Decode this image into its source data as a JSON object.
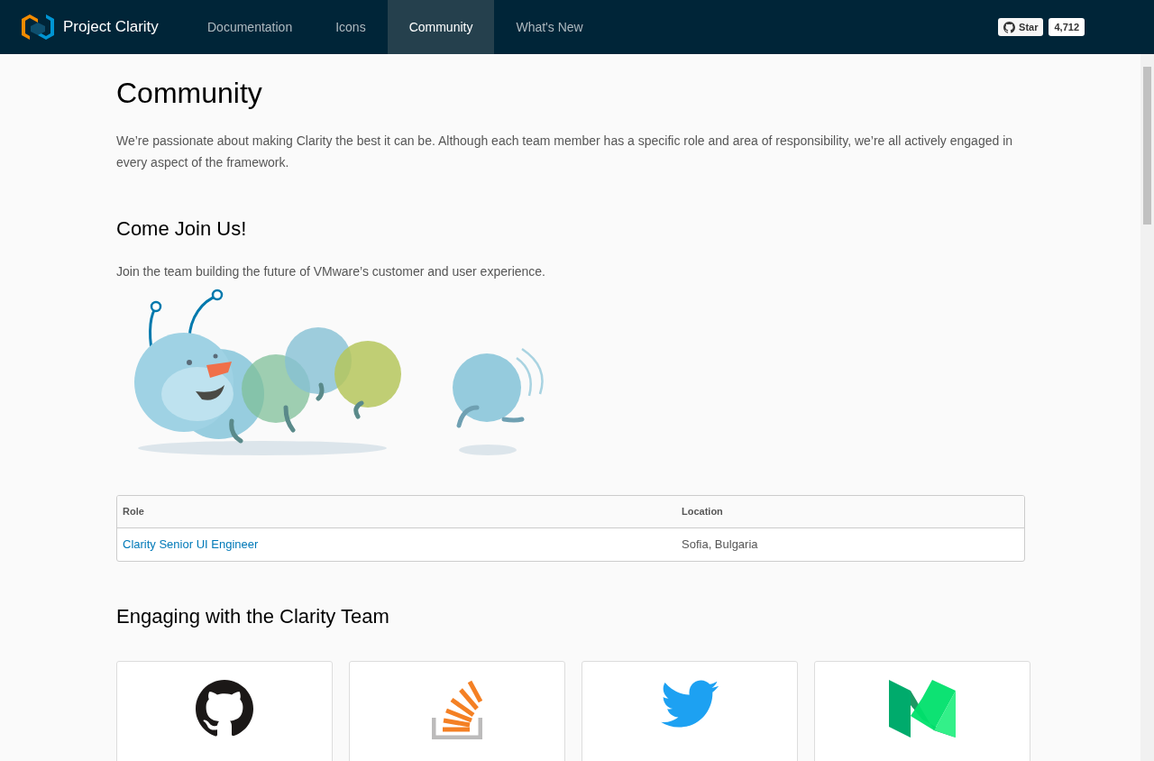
{
  "nav": {
    "brand": "Project Clarity",
    "tabs": [
      {
        "label": "Documentation",
        "selected": false
      },
      {
        "label": "Icons",
        "selected": false
      },
      {
        "label": "Community",
        "selected": true
      },
      {
        "label": "What's New",
        "selected": false
      }
    ]
  },
  "github": {
    "star": "Star",
    "count": "4,712"
  },
  "title": "Community",
  "intro": "We’re passionate about making Clarity the best it can be. Although each team member has a specific role and area of responsibility, we’re all actively engaged in every aspect of the framework.",
  "join": {
    "heading": "Come Join Us!",
    "text": "Join the team building the future of VMware’s customer and user experience."
  },
  "table": {
    "columns": [
      "Role",
      "Location"
    ],
    "rows": [
      {
        "role": "Clarity Senior UI Engineer",
        "location": "Sofia, Bulgaria"
      }
    ]
  },
  "engaging": {
    "heading": "Engaging with the Clarity Team",
    "cards": [
      {
        "kind": "github"
      },
      {
        "kind": "stackoverflow"
      },
      {
        "kind": "twitter"
      },
      {
        "kind": "medium"
      }
    ]
  }
}
